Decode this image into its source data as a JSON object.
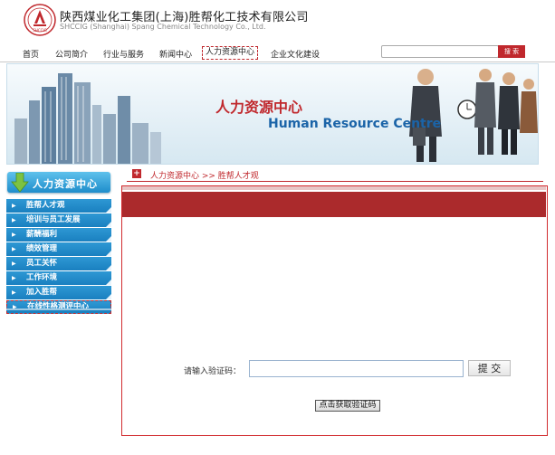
{
  "company": {
    "name_cn": "陕西煤业化工集团(上海)胜帮化工技术有限公司",
    "name_en": "SHCCIG (Shanghai) Spang Chemical Technology Co., Ltd.",
    "logo_text": "SHCCIG",
    "brand_color": "#c0282d"
  },
  "nav": {
    "items": [
      {
        "label": "首页"
      },
      {
        "label": "公司简介"
      },
      {
        "label": "行业与服务"
      },
      {
        "label": "新闻中心"
      },
      {
        "label": "人力资源中心"
      },
      {
        "label": "企业文化建设"
      }
    ],
    "active_index": 4,
    "search_placeholder": "",
    "search_label": "搜 索"
  },
  "banner": {
    "title_cn": "人力资源中心",
    "title_en": "Human Resource Centre"
  },
  "sidebar": {
    "heading": "人力资源中心",
    "items": [
      {
        "label": "胜帮人才观"
      },
      {
        "label": "培训与员工发展"
      },
      {
        "label": "薪酬福利"
      },
      {
        "label": "绩效管理"
      },
      {
        "label": "员工关怀"
      },
      {
        "label": "工作环境"
      },
      {
        "label": "加入胜帮"
      },
      {
        "label": "在线性格测评中心"
      }
    ]
  },
  "breadcrumb": {
    "icon": "plus-icon",
    "text": "人力资源中心 >> 胜帮人才观"
  },
  "form": {
    "code_label": "请输入验证码：",
    "code_value": "",
    "submit_label": "提 交",
    "get_code_label": "点击获取验证码"
  }
}
